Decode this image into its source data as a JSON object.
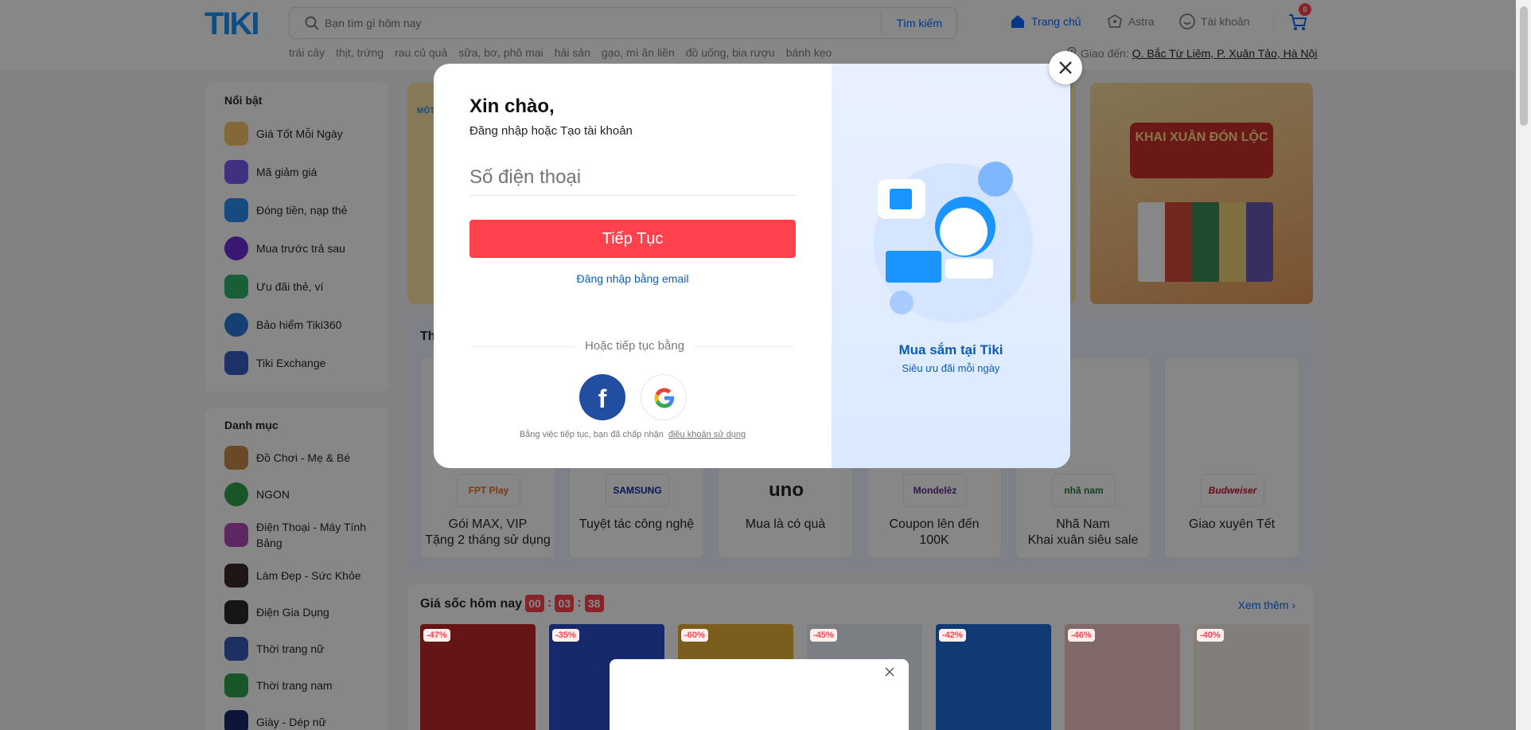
{
  "header": {
    "logo": "TIKI",
    "search_placeholder": "Bạn tìm gì hôm nay",
    "search_button": "Tìm kiếm",
    "nav": {
      "home": "Trang chủ",
      "astra": "Astra",
      "account": "Tài khoản"
    },
    "cart_count": "0",
    "quick_links": [
      "trái cây",
      "thịt, trứng",
      "rau củ quả",
      "sữa, bơ, phô mai",
      "hải sản",
      "gạo, mì ăn liền",
      "đồ uống, bia rượu",
      "bánh kẹo"
    ],
    "deliver_label": "Giao đến:",
    "deliver_address": "Q. Bắc Từ Liêm, P. Xuân Tảo, Hà Nội"
  },
  "sidebar": {
    "featured_title": "Nổi bật",
    "featured": [
      {
        "label": "Giá Tốt Mỗi Ngày",
        "color": "#f7c46c"
      },
      {
        "label": "Mã giảm giá",
        "color": "#7b5cf0"
      },
      {
        "label": "Đóng tiền, nạp thẻ",
        "color": "#2f8cf5"
      },
      {
        "label": "Mua trước trả sau",
        "color": "#6b2fd6"
      },
      {
        "label": "Ưu đãi thẻ, ví",
        "color": "#2fb36b"
      },
      {
        "label": "Bảo hiểm Tiki360",
        "color": "#2a7ad9"
      },
      {
        "label": "Tiki Exchange",
        "color": "#3a5fc9"
      }
    ],
    "category_title": "Danh mục",
    "categories": [
      {
        "label": "Đồ Chơi - Mẹ & Bé",
        "color": "#c88a4a"
      },
      {
        "label": "NGON",
        "color": "#2fa34b"
      },
      {
        "label": "Điện Thoại - Máy Tính Bảng",
        "color": "#b24ab8"
      },
      {
        "label": "Làm Đẹp - Sức Khỏe",
        "color": "#3b2a2a"
      },
      {
        "label": "Điện Gia Dụng",
        "color": "#2a2a2a"
      },
      {
        "label": "Thời trang nữ",
        "color": "#3a5ab8"
      },
      {
        "label": "Thời trang nam",
        "color": "#2fa34b"
      },
      {
        "label": "Giày - Dép nữ",
        "color": "#1a2a6b"
      }
    ]
  },
  "banner": {
    "left_label": "MỘT",
    "right_title": "KHAI XUÂN ĐÓN LỘC"
  },
  "categories_section": {
    "title": "Th",
    "cards": [
      {
        "brand": "FPT Play",
        "caption": "Gói MAX, VIP\nTặng 2 tháng sử dụng",
        "brand_color": "#f26a21"
      },
      {
        "brand": "SAMSUNG",
        "caption": "Tuyệt tác công nghệ",
        "brand_color": "#1428a0"
      },
      {
        "brand": "uno",
        "caption": "Mua là có quà",
        "brand_color": "#222222"
      },
      {
        "brand": "Mondelēz",
        "caption": "Coupon lên đến\n100K",
        "brand_color": "#5b2a86"
      },
      {
        "brand": "nhã nam",
        "caption": "Nhã Nam\nKhai xuân siêu sale",
        "brand_color": "#2a7a3a"
      },
      {
        "brand": "Budweiser",
        "caption": "Giao xuyên Tết",
        "brand_color": "#c8102e"
      }
    ]
  },
  "flash_sale": {
    "title": "Giá sốc hôm nay",
    "timer": [
      "00",
      "03",
      "38"
    ],
    "see_more": "Xem thêm",
    "products": [
      {
        "discount": "-47%",
        "color": "#c0282d"
      },
      {
        "discount": "-35%",
        "color": "#2a4ec9"
      },
      {
        "discount": "-60%",
        "color": "#e8b23a"
      },
      {
        "discount": "-45%",
        "color": "#e8eef5"
      },
      {
        "discount": "-42%",
        "color": "#1e6fd9"
      },
      {
        "discount": "-46%",
        "color": "#f5c7c7"
      },
      {
        "discount": "-40%",
        "color": "#f5f0e6"
      }
    ]
  },
  "modal": {
    "greeting": "Xin chào,",
    "subtitle": "Đăng nhập hoặc Tạo tài khoản",
    "phone_placeholder": "Số điện thoại",
    "continue_button": "Tiếp Tục",
    "email_login": "Đăng nhập bằng email",
    "or_continue": "Hoặc tiếp tục bằng",
    "terms_prefix": "Bằng việc tiếp tục, bạn đã chấp nhận",
    "terms_link": "điều khoản sử dụng",
    "right_title": "Mua sắm tại Tiki",
    "right_subtitle": "Siêu ưu đãi mỗi ngày"
  },
  "colors": {
    "brand": "#1a94ff",
    "accent_red": "#ff424e",
    "link_blue": "#0d5cb6"
  }
}
